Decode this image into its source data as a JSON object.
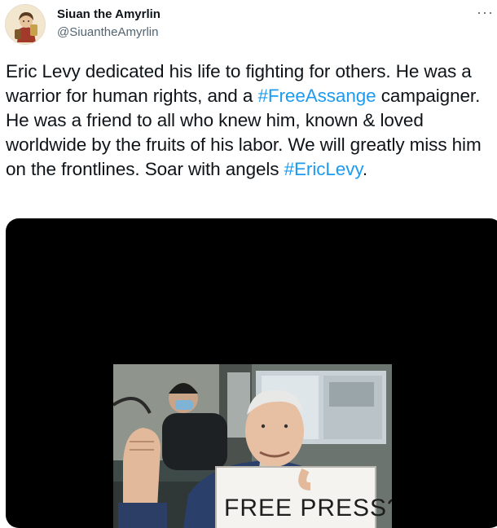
{
  "user": {
    "display_name": "Siuan the Amyrlin",
    "handle": "@SiuantheAmyrlin",
    "avatar_icon": "cartoon-avatar-icon"
  },
  "more_icon": "more-options-icon",
  "tweet": {
    "text_part1": "Eric Levy dedicated his life to fighting for others. He was a warrior for human rights, and a ",
    "hashtag1": "#FreeAssange",
    "text_part2": " campaigner. He was a friend to all who knew him, known & loved worldwide by the fruits of his labor. We will greatly miss him on the frontlines. Soar with angels ",
    "hashtag2": "#EricLevy",
    "text_part3": "."
  },
  "media": {
    "sign_text": "FREE PRESS?"
  },
  "colors": {
    "link": "#1d9bf0",
    "text": "#0f1419",
    "secondary": "#536471",
    "media_bg": "#000000"
  }
}
